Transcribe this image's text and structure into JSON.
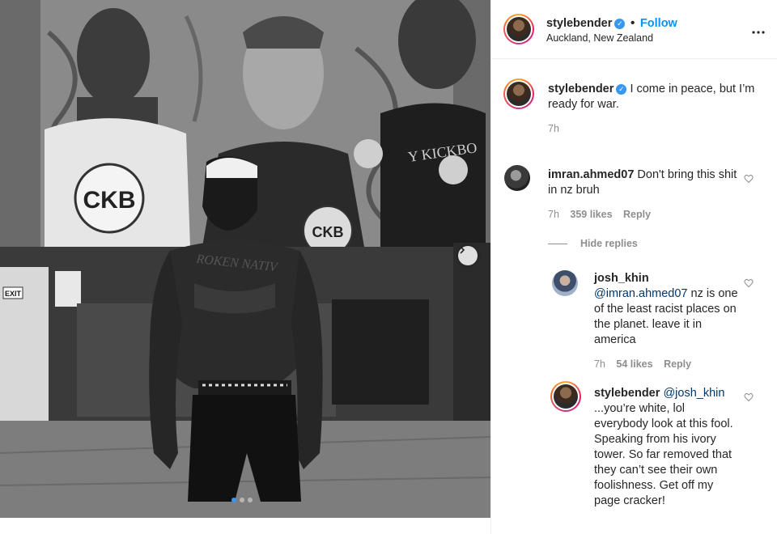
{
  "post": {
    "username": "stylebender",
    "follow_label": "Follow",
    "separator": "•",
    "location": "Auckland, New Zealand",
    "more_label": "•••"
  },
  "photo": {
    "banner_text_left": "CKB",
    "banner_text_mid": "CKB",
    "banner_shirt_text": "Y KICKBO",
    "tattoo_text": "ROKEN NATIV",
    "exit_sign": "EXIT",
    "carousel_index": 1,
    "carousel_total": 3
  },
  "caption": {
    "username": "stylebender",
    "text": "I come in peace, but I’m ready for war.",
    "time": "7h"
  },
  "comments": [
    {
      "username": "imran.ahmed07",
      "text": "Don't bring this shit in nz bruh",
      "time": "7h",
      "likes": "359 likes",
      "reply": "Reply",
      "hide_replies": "Hide replies"
    }
  ],
  "replies": [
    {
      "username": "josh_khin",
      "mention": "@imran.ahmed07",
      "text": "nz is one of the least racist places on the planet. leave it in america",
      "time": "7h",
      "likes": "54 likes",
      "reply": "Reply"
    },
    {
      "username": "stylebender",
      "mention": "@josh_khin",
      "text": "...you’re white, lol everybody look at this fool. Speaking from his ivory tower. So far removed that they can’t see their own foolishness. Get off my page cracker!"
    }
  ],
  "colors": {
    "link": "#0095f6",
    "mention": "#00376b",
    "verified": "#3897f0",
    "muted": "#8e8e8e"
  }
}
